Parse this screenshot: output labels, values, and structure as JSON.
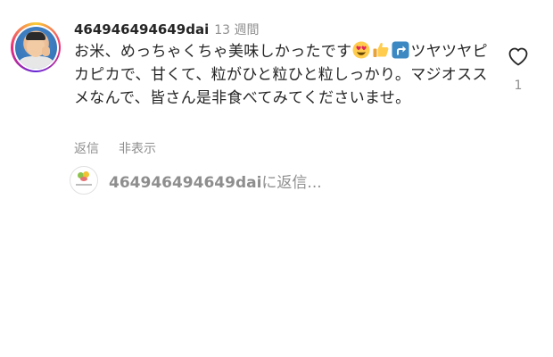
{
  "comment": {
    "username": "464946494649dai",
    "time": "13 週間",
    "text_part1": "お米、めっちゃくちゃ美味しかったです",
    "text_part2": "ツヤツヤピカピカで、甘くて、粒がひと粒ひと粒しっかり。マジオススメなんで、皆さん是非食べてみてくださいませ。",
    "emojis": [
      "heart-eyes-emoji",
      "thumbs-up-emoji",
      "up-arrow-emoji"
    ],
    "actions": {
      "reply_label": "返信",
      "hide_label": "非表示"
    },
    "like": {
      "count": "1",
      "icon": "heart-outline-icon"
    }
  },
  "reply_box": {
    "target_user": "464946494649dai",
    "suffix": "に返信..."
  },
  "colors": {
    "text": "#262626",
    "secondary": "#8e8e8e",
    "background": "#ffffff"
  }
}
